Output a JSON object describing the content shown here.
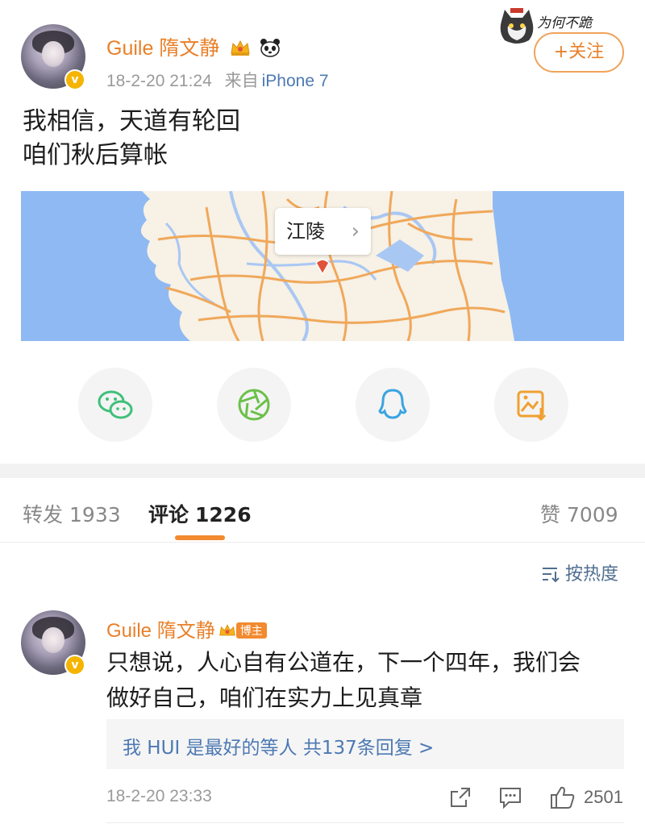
{
  "post": {
    "username": "Guile 隋文静",
    "timestamp": "18-2-20 21:24",
    "source_prefix": "来自",
    "source": "iPhone 7",
    "follow_label": "+关注",
    "text_lines": [
      "我相信，天道有轮回",
      "咱们秋后算帐"
    ],
    "location": "江陵"
  },
  "sticker": {
    "text": "为何不跪"
  },
  "share_buttons": [
    "wechat-icon",
    "moments-icon",
    "qq-icon",
    "save-image-icon"
  ],
  "tabs": {
    "repost_label": "转发",
    "repost_count": "1933",
    "comment_label": "评论",
    "comment_count": "1226",
    "like_label": "赞",
    "like_count": "7009"
  },
  "sort_label": "按热度",
  "comment": {
    "username": "Guile 隋文静",
    "badge": "博主",
    "text_lines": [
      "只想说，人心自有公道在，下一个四年，我们会",
      "做好自己，咱们在实力上见真章"
    ],
    "reply_summary": "我 HUI 是最好的等人  共137条回复 >",
    "timestamp": "18-2-20 23:33",
    "like_count": "2501"
  },
  "colors": {
    "accent": "#e8802a",
    "link": "#4d79b3",
    "map_water": "#8fb9f2",
    "map_land": "#f7f1e6",
    "road": "#f0a85a"
  }
}
